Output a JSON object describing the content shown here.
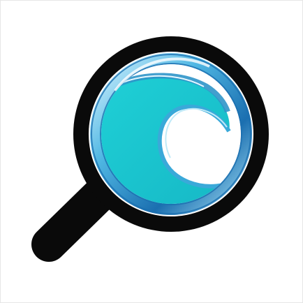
{
  "logo": {
    "icon": "magnifier-wave-icon",
    "colors": {
      "outline": "#0a0a0a",
      "ring_light": "#bfeaf8",
      "ring_mid": "#3aa9d9",
      "ring_dark": "#1b6fb0",
      "wave": "#22c6cf",
      "lens_white": "#ffffff",
      "background": "#ffffff"
    }
  }
}
